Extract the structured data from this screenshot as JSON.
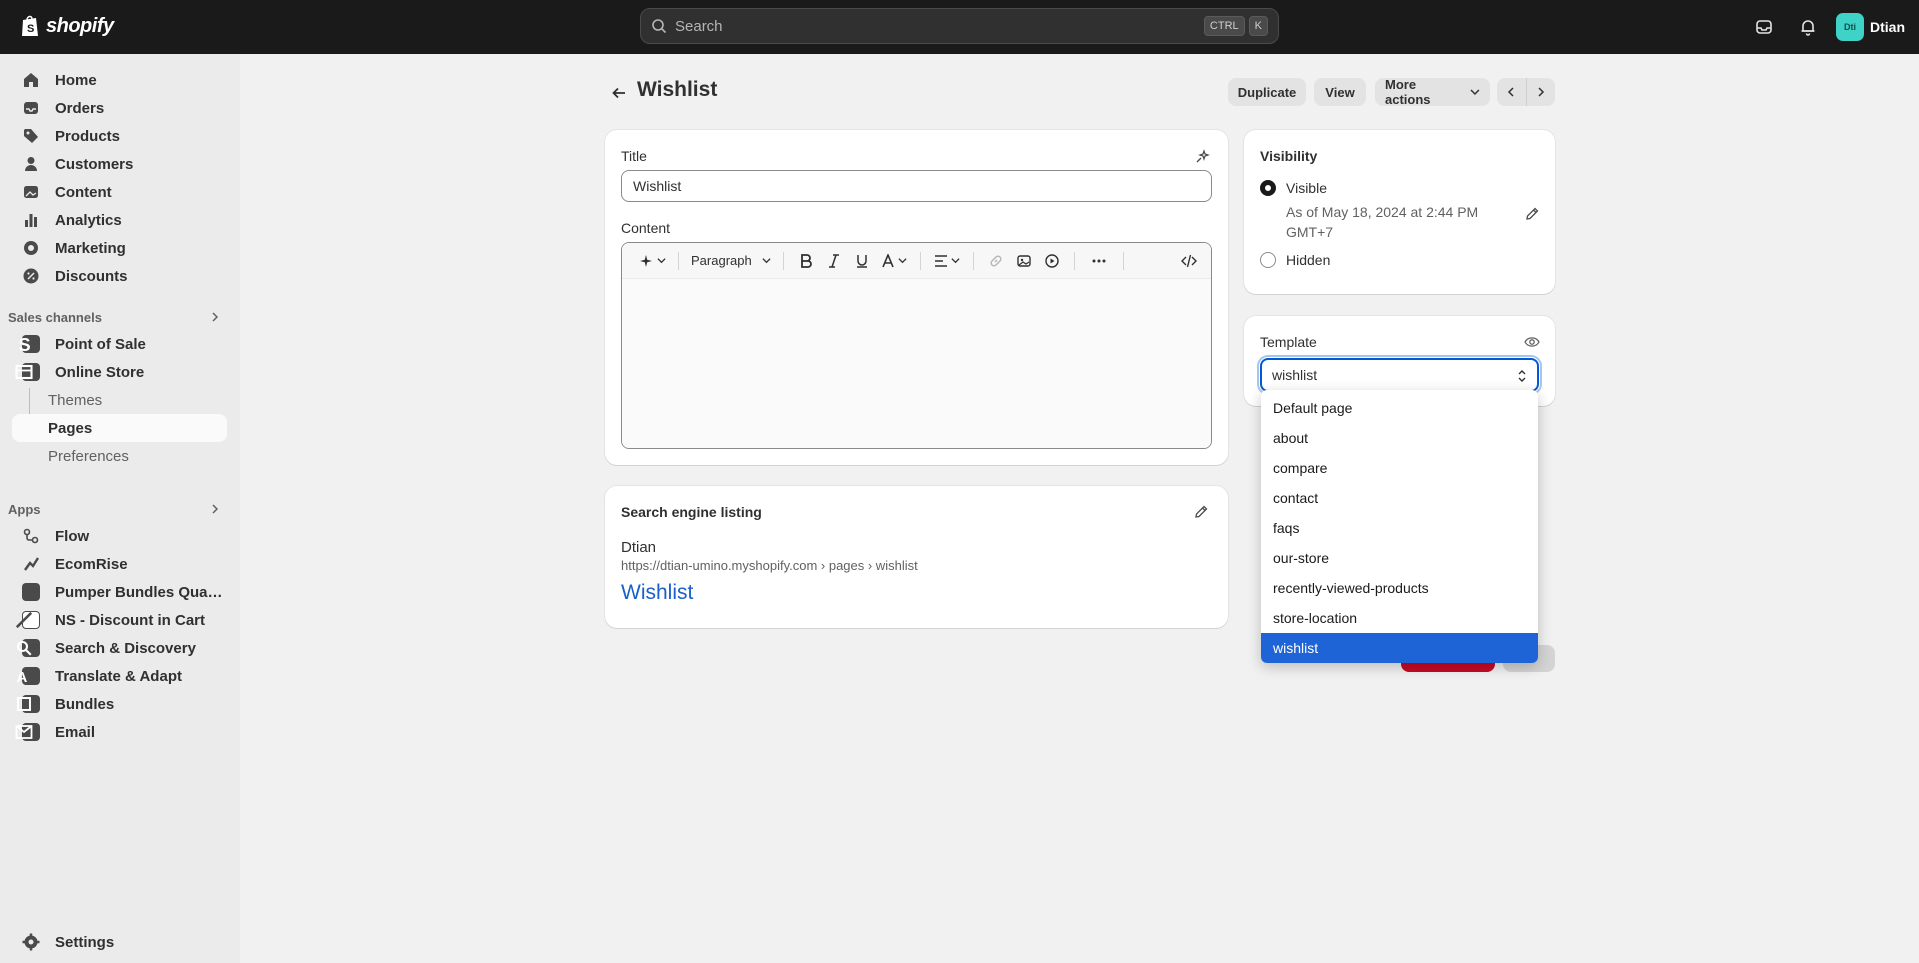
{
  "topbar": {
    "logo_text": "shopify",
    "search_placeholder": "Search",
    "shortcut_ctrl": "CTRL",
    "shortcut_key": "K",
    "avatar_initials": "Dti",
    "store_name": "Dtian"
  },
  "sidebar": {
    "main": [
      "Home",
      "Orders",
      "Products",
      "Customers",
      "Content",
      "Analytics",
      "Marketing",
      "Discounts"
    ],
    "sales_channels_label": "Sales channels",
    "point_of_sale": "Point of Sale",
    "online_store": "Online Store",
    "online_store_sub": [
      "Themes",
      "Pages",
      "Preferences"
    ],
    "apps_label": "Apps",
    "apps": [
      "Flow",
      "EcomRise",
      "Pumper Bundles Quantity ...",
      "NS - Discount in Cart",
      "Search & Discovery",
      "Translate & Adapt",
      "Bundles",
      "Email"
    ],
    "settings": "Settings"
  },
  "header": {
    "title": "Wishlist",
    "duplicate": "Duplicate",
    "view": "View",
    "more_actions": "More actions"
  },
  "content_card": {
    "title_label": "Title",
    "title_value": "Wishlist",
    "content_label": "Content",
    "format_value": "Paragraph"
  },
  "seo_card": {
    "heading": "Search engine listing",
    "store": "Dtian",
    "url": "https://dtian-umino.myshopify.com › pages › wishlist",
    "link_title": "Wishlist"
  },
  "visibility": {
    "heading": "Visibility",
    "visible_label": "Visible",
    "visible_date_line1": "As of May 18, 2024 at 2:44 PM",
    "visible_date_line2": "GMT+7",
    "hidden_label": "Hidden"
  },
  "template": {
    "heading": "Template",
    "selected": "wishlist",
    "options": [
      "Default page",
      "about",
      "compare",
      "contact",
      "faqs",
      "our-store",
      "recently-viewed-products",
      "store-location",
      "wishlist"
    ]
  },
  "colors": {
    "topbar": "#1a1a1a",
    "sidebar": "#ebebeb",
    "accent": "#005bd3",
    "selected_option": "#1e64d6",
    "danger": "#c70a24"
  }
}
